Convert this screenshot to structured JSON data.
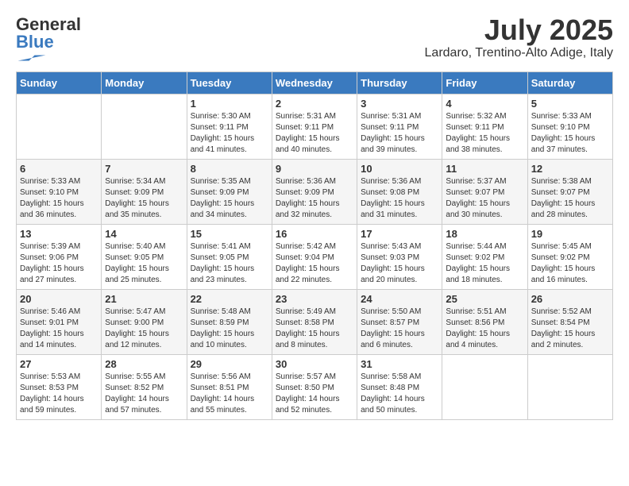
{
  "header": {
    "logo_line1": "General",
    "logo_line2": "Blue",
    "month_title": "July 2025",
    "subtitle": "Lardaro, Trentino-Alto Adige, Italy"
  },
  "days_of_week": [
    "Sunday",
    "Monday",
    "Tuesday",
    "Wednesday",
    "Thursday",
    "Friday",
    "Saturday"
  ],
  "weeks": [
    [
      {
        "day": "",
        "info": ""
      },
      {
        "day": "",
        "info": ""
      },
      {
        "day": "1",
        "info": "Sunrise: 5:30 AM\nSunset: 9:11 PM\nDaylight: 15 hours and 41 minutes."
      },
      {
        "day": "2",
        "info": "Sunrise: 5:31 AM\nSunset: 9:11 PM\nDaylight: 15 hours and 40 minutes."
      },
      {
        "day": "3",
        "info": "Sunrise: 5:31 AM\nSunset: 9:11 PM\nDaylight: 15 hours and 39 minutes."
      },
      {
        "day": "4",
        "info": "Sunrise: 5:32 AM\nSunset: 9:11 PM\nDaylight: 15 hours and 38 minutes."
      },
      {
        "day": "5",
        "info": "Sunrise: 5:33 AM\nSunset: 9:10 PM\nDaylight: 15 hours and 37 minutes."
      }
    ],
    [
      {
        "day": "6",
        "info": "Sunrise: 5:33 AM\nSunset: 9:10 PM\nDaylight: 15 hours and 36 minutes."
      },
      {
        "day": "7",
        "info": "Sunrise: 5:34 AM\nSunset: 9:09 PM\nDaylight: 15 hours and 35 minutes."
      },
      {
        "day": "8",
        "info": "Sunrise: 5:35 AM\nSunset: 9:09 PM\nDaylight: 15 hours and 34 minutes."
      },
      {
        "day": "9",
        "info": "Sunrise: 5:36 AM\nSunset: 9:09 PM\nDaylight: 15 hours and 32 minutes."
      },
      {
        "day": "10",
        "info": "Sunrise: 5:36 AM\nSunset: 9:08 PM\nDaylight: 15 hours and 31 minutes."
      },
      {
        "day": "11",
        "info": "Sunrise: 5:37 AM\nSunset: 9:07 PM\nDaylight: 15 hours and 30 minutes."
      },
      {
        "day": "12",
        "info": "Sunrise: 5:38 AM\nSunset: 9:07 PM\nDaylight: 15 hours and 28 minutes."
      }
    ],
    [
      {
        "day": "13",
        "info": "Sunrise: 5:39 AM\nSunset: 9:06 PM\nDaylight: 15 hours and 27 minutes."
      },
      {
        "day": "14",
        "info": "Sunrise: 5:40 AM\nSunset: 9:05 PM\nDaylight: 15 hours and 25 minutes."
      },
      {
        "day": "15",
        "info": "Sunrise: 5:41 AM\nSunset: 9:05 PM\nDaylight: 15 hours and 23 minutes."
      },
      {
        "day": "16",
        "info": "Sunrise: 5:42 AM\nSunset: 9:04 PM\nDaylight: 15 hours and 22 minutes."
      },
      {
        "day": "17",
        "info": "Sunrise: 5:43 AM\nSunset: 9:03 PM\nDaylight: 15 hours and 20 minutes."
      },
      {
        "day": "18",
        "info": "Sunrise: 5:44 AM\nSunset: 9:02 PM\nDaylight: 15 hours and 18 minutes."
      },
      {
        "day": "19",
        "info": "Sunrise: 5:45 AM\nSunset: 9:02 PM\nDaylight: 15 hours and 16 minutes."
      }
    ],
    [
      {
        "day": "20",
        "info": "Sunrise: 5:46 AM\nSunset: 9:01 PM\nDaylight: 15 hours and 14 minutes."
      },
      {
        "day": "21",
        "info": "Sunrise: 5:47 AM\nSunset: 9:00 PM\nDaylight: 15 hours and 12 minutes."
      },
      {
        "day": "22",
        "info": "Sunrise: 5:48 AM\nSunset: 8:59 PM\nDaylight: 15 hours and 10 minutes."
      },
      {
        "day": "23",
        "info": "Sunrise: 5:49 AM\nSunset: 8:58 PM\nDaylight: 15 hours and 8 minutes."
      },
      {
        "day": "24",
        "info": "Sunrise: 5:50 AM\nSunset: 8:57 PM\nDaylight: 15 hours and 6 minutes."
      },
      {
        "day": "25",
        "info": "Sunrise: 5:51 AM\nSunset: 8:56 PM\nDaylight: 15 hours and 4 minutes."
      },
      {
        "day": "26",
        "info": "Sunrise: 5:52 AM\nSunset: 8:54 PM\nDaylight: 15 hours and 2 minutes."
      }
    ],
    [
      {
        "day": "27",
        "info": "Sunrise: 5:53 AM\nSunset: 8:53 PM\nDaylight: 14 hours and 59 minutes."
      },
      {
        "day": "28",
        "info": "Sunrise: 5:55 AM\nSunset: 8:52 PM\nDaylight: 14 hours and 57 minutes."
      },
      {
        "day": "29",
        "info": "Sunrise: 5:56 AM\nSunset: 8:51 PM\nDaylight: 14 hours and 55 minutes."
      },
      {
        "day": "30",
        "info": "Sunrise: 5:57 AM\nSunset: 8:50 PM\nDaylight: 14 hours and 52 minutes."
      },
      {
        "day": "31",
        "info": "Sunrise: 5:58 AM\nSunset: 8:48 PM\nDaylight: 14 hours and 50 minutes."
      },
      {
        "day": "",
        "info": ""
      },
      {
        "day": "",
        "info": ""
      }
    ]
  ]
}
